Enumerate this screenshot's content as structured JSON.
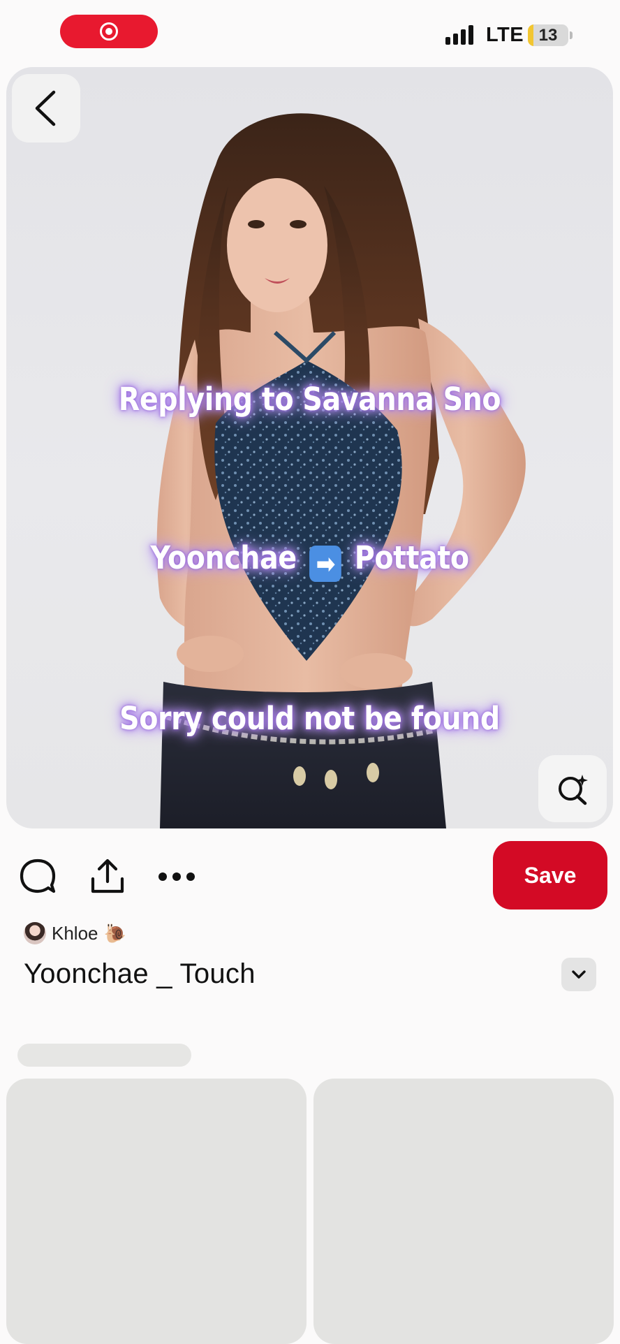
{
  "status_bar": {
    "network": "LTE",
    "battery": "13",
    "battery_level_percent": 13,
    "record_color": "#e8192f"
  },
  "pin": {
    "overlay_lines": [
      "Replying to Savanna Sno",
      "Yoonchae",
      "Pottato",
      "Sorry could not be found"
    ],
    "arrow_emoji": "➡"
  },
  "actions": {
    "save_label": "Save",
    "save_color": "#d30a25",
    "icons": [
      "comment-icon",
      "share-icon",
      "more-icon"
    ]
  },
  "author": {
    "name": "Khloe",
    "emoji": "🐌"
  },
  "title": "Yoonchae _ Touch"
}
